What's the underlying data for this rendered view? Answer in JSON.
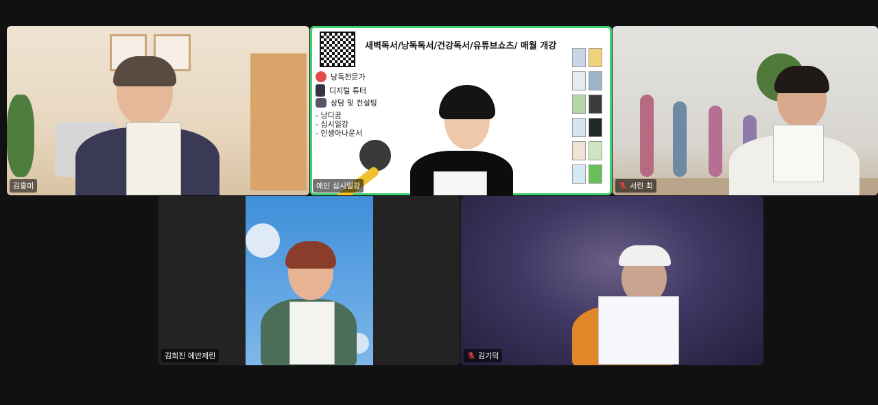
{
  "participants": {
    "p1": {
      "name": "김홍미",
      "muted": false
    },
    "p2": {
      "name": "예인 십시일강",
      "muted": false
    },
    "p3": {
      "name": "서린 최",
      "muted": true
    },
    "p4": {
      "name": "김희진 에반제린",
      "muted": false
    },
    "p5": {
      "name": "김기덕",
      "muted": true
    }
  },
  "slide": {
    "title": "새벽독서/낭독독서/건강독서/유튜브쇼츠/ 매월 개강",
    "items": [
      "낭독전문가",
      "디지털 튜터",
      "상담 및 컨설팅"
    ],
    "list": [
      "- 낭디꿈",
      "- 십시일강",
      "- 인생아나운서"
    ]
  },
  "colors": {
    "active_speaker": "#3ccf6e",
    "background": "#111112"
  }
}
